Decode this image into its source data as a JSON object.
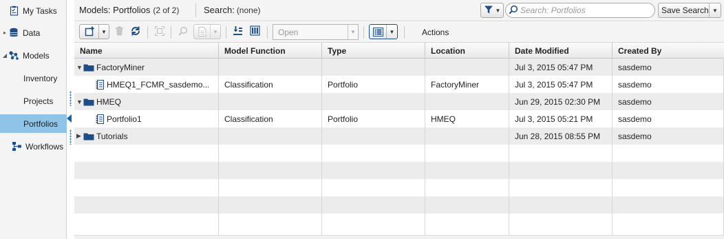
{
  "sidebar": {
    "items": [
      {
        "label": "My Tasks",
        "icon": "tasks-icon"
      },
      {
        "label": "Data",
        "icon": "database-icon"
      },
      {
        "label": "Models",
        "icon": "models-icon"
      },
      {
        "label": "Inventory"
      },
      {
        "label": "Projects"
      },
      {
        "label": "Portfolios",
        "selected": true
      },
      {
        "label": "Workflows",
        "icon": "workflow-icon"
      }
    ],
    "selected_color": "#8fc3e7"
  },
  "header": {
    "title": "Models: Portfolios",
    "count": "(2 of 2)",
    "search_label": "Search:",
    "search_value": "(none)",
    "search_placeholder": "Search: Portfolios",
    "save_search_label": "Save Search"
  },
  "toolbar": {
    "open_value": "Open",
    "actions_label": "Actions"
  },
  "table": {
    "columns": [
      "Name",
      "Model Function",
      "Type",
      "Location",
      "Date Modified",
      "Created By"
    ],
    "rows": [
      {
        "kind": "folder",
        "expanded": true,
        "name": "FactoryMiner",
        "function": "",
        "type": "",
        "location": "",
        "date": "Jul 3, 2015 05:47 PM",
        "created_by": "sasdemo"
      },
      {
        "kind": "item",
        "name": "HMEQ1_FCMR_sasdemo...",
        "function": "Classification",
        "type": "Portfolio",
        "location": "FactoryMiner",
        "date": "Jul 3, 2015 05:47 PM",
        "created_by": "sasdemo"
      },
      {
        "kind": "folder",
        "expanded": true,
        "name": "HMEQ",
        "function": "",
        "type": "",
        "location": "",
        "date": "Jun 29, 2015 02:30 PM",
        "created_by": "sasdemo"
      },
      {
        "kind": "item",
        "name": "Portfolio1",
        "function": "Classification",
        "type": "Portfolio",
        "location": "HMEQ",
        "date": "Jul 3, 2015 05:21 PM",
        "created_by": "sasdemo"
      },
      {
        "kind": "folder",
        "expanded": false,
        "name": "Tutorials",
        "function": "",
        "type": "",
        "location": "",
        "date": "Jun 28, 2015 08:55 PM",
        "created_by": "sasdemo"
      }
    ]
  },
  "colors": {
    "accent": "#1a5ea8",
    "folder": "#1f4e87",
    "stripe": "#ececec"
  }
}
